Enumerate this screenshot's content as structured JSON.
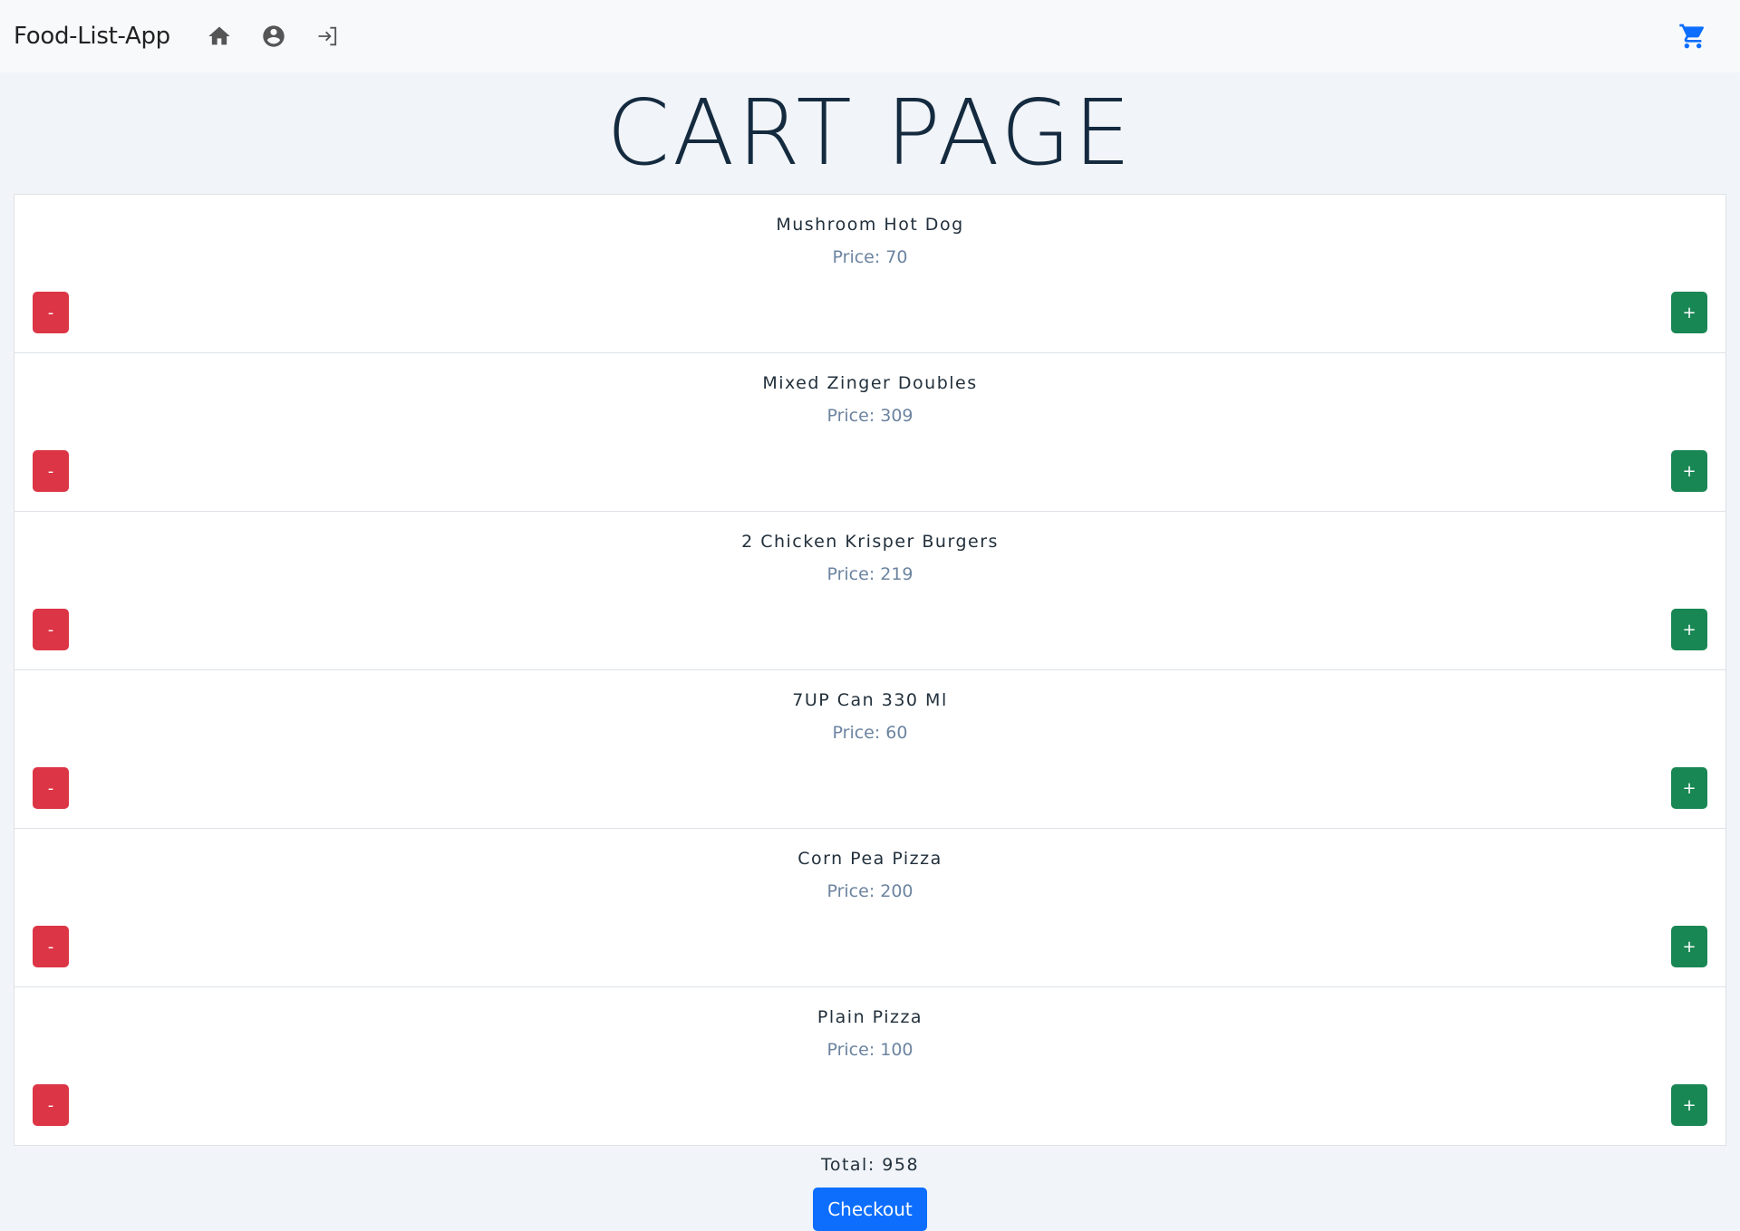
{
  "navbar": {
    "brand": "Food-List-App",
    "icons": [
      "home-icon",
      "account-circle-icon",
      "login-icon"
    ],
    "cart_icon": "cart-icon",
    "cart_color": "#0d6efd"
  },
  "page_title": "CART PAGE",
  "items": [
    {
      "name": "Mushroom Hot Dog",
      "price": "Price: 70",
      "minus": "-",
      "plus": "+"
    },
    {
      "name": "Mixed Zinger Doubles",
      "price": "Price: 309",
      "minus": "-",
      "plus": "+"
    },
    {
      "name": "2 Chicken Krisper Burgers",
      "price": "Price: 219",
      "minus": "-",
      "plus": "+"
    },
    {
      "name": "7UP Can 330 Ml",
      "price": "Price: 60",
      "minus": "-",
      "plus": "+"
    },
    {
      "name": "Corn Pea Pizza",
      "price": "Price: 200",
      "minus": "-",
      "plus": "+"
    },
    {
      "name": "Plain Pizza",
      "price": "Price: 100",
      "minus": "-",
      "plus": "+"
    }
  ],
  "total": "Total: 958",
  "checkout_label": "Checkout",
  "colors": {
    "minus_button": "#dc3545",
    "plus_button": "#198754",
    "checkout_button": "#0d6efd"
  }
}
